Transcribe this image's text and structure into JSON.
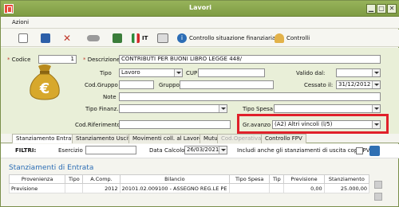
{
  "window": {
    "title": "Lavori"
  },
  "menu": {
    "azioni": "Azioni"
  },
  "toolbar": {
    "controllo_situazione": "Controllo situazione finanziaria…",
    "controlli": "Controlli",
    "it_label": "IT"
  },
  "form": {
    "codice_label": "Codice",
    "codice_value": "1",
    "descrizione_label": "Descrizione",
    "descrizione_value": "CONTRIBUTI PER BUONI LIBRO  LEGGE 448/",
    "tipo_label": "Tipo",
    "tipo_value": "Lavoro",
    "cup_label": "CUP",
    "cup_value": "",
    "valido_dal_label": "Valido dal:",
    "valido_dal_value": "",
    "cod_gruppo_label": "Cod.Gruppo",
    "cod_gruppo_value": "",
    "gruppo_label": "Gruppo",
    "gruppo_value": "",
    "cessato_il_label": "Cessato il:",
    "cessato_il_value": "31/12/2012",
    "note_label": "Note",
    "note_value": "",
    "tipo_finanz_label": "Tipo Finanz.",
    "tipo_finanz_value": "",
    "tipo_spesa_label": "Tipo Spesa",
    "tipo_spesa_value": "",
    "cod_riferimento_label": "Cod.Riferimento",
    "cod_riferimento_value": "",
    "gr_avanzo_label": "Gr.avanzo",
    "gr_avanzo_value": "(A2) Altri vincoli (l/5)"
  },
  "tabs": [
    {
      "label": "Stanziamento Entrata"
    },
    {
      "label": "Stanziamento Uscita"
    },
    {
      "label": "Movimenti coll. al Lavoro"
    },
    {
      "label": "Mutui"
    },
    {
      "label": "Cod.Operativa"
    },
    {
      "label": "Controllo FPV"
    }
  ],
  "filters": {
    "label": "FILTRI:",
    "esercizio_label": "Esercizio",
    "esercizio_value": "",
    "data_calcolo_label": "Data Calcolo",
    "data_calcolo_value": "26/03/2021",
    "includi_label": "Includi anche gli stanziamenti di uscita cop.FPV"
  },
  "section_title": "Stanziamenti di Entrata",
  "table": {
    "headers": [
      "Provenienza",
      "Tipo",
      "A.Comp.",
      "Bilancio",
      "Tipo Spesa",
      "Tip",
      "Previsione",
      "Stanziamento"
    ],
    "rows": [
      [
        "Previsione",
        "",
        "2012",
        "20101.02.009100 - ASSEGNO REG.LE PE",
        "",
        "",
        "0,00",
        "25.000,00"
      ]
    ]
  }
}
